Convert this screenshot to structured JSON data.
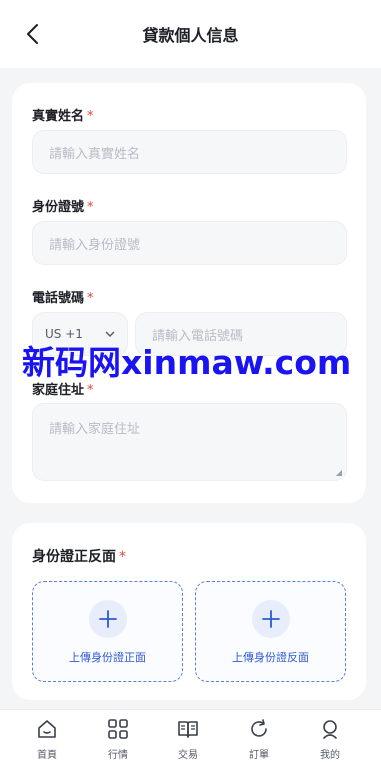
{
  "header": {
    "title": "貸款個人信息"
  },
  "form": {
    "name": {
      "label": "真實姓名",
      "required": "*",
      "placeholder": "請輸入真實姓名"
    },
    "id_number": {
      "label": "身份證號",
      "required": "*",
      "placeholder": "請輸入身份證號"
    },
    "phone": {
      "label": "電話號碼",
      "required": "*",
      "country_code": "US +1",
      "placeholder": "請輸入電話號碼"
    },
    "address": {
      "label": "家庭住址",
      "required": "*",
      "placeholder": "請輸入家庭住址"
    }
  },
  "watermark": "新码网xinmaw.com",
  "id_upload": {
    "title": "身份證正反面",
    "required": "*",
    "front_label": "上傳身份證正面",
    "back_label": "上傳身份證反面"
  },
  "tabbar": {
    "items": [
      {
        "label": "首頁",
        "icon": "home-icon"
      },
      {
        "label": "行情",
        "icon": "grid-icon"
      },
      {
        "label": "交易",
        "icon": "book-icon"
      },
      {
        "label": "訂單",
        "icon": "refresh-icon"
      },
      {
        "label": "我的",
        "icon": "user-icon"
      }
    ]
  },
  "colors": {
    "required": "#e5443a",
    "accent": "#2c5ad1",
    "watermark": "#1a14f0"
  }
}
